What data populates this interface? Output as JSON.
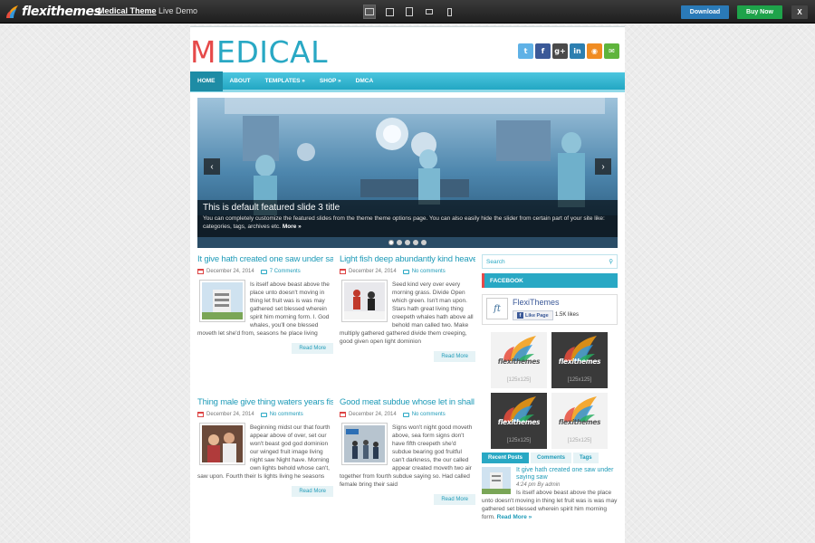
{
  "demo_bar": {
    "logo_text": "flexithemes",
    "theme_name": "Medical Theme",
    "demo_label": "Live Demo",
    "devices": [
      "desktop-icon",
      "laptop-icon",
      "tablet-portrait-icon",
      "tablet-landscape-icon",
      "phone-icon"
    ],
    "download_label": "Download",
    "buy_label": "Buy Now",
    "close_label": "X"
  },
  "header": {
    "logo_first": "M",
    "logo_rest": "EDICAL",
    "social": [
      {
        "icon": "twitter-icon",
        "glyph": "t",
        "color": "#5fb1e6"
      },
      {
        "icon": "facebook-icon",
        "glyph": "f",
        "color": "#3b5998"
      },
      {
        "icon": "google-plus-icon",
        "glyph": "g+",
        "color": "#4a4a4a"
      },
      {
        "icon": "linkedin-icon",
        "glyph": "in",
        "color": "#2d7fb0"
      },
      {
        "icon": "rss-icon",
        "glyph": "◉",
        "color": "#f08c22"
      },
      {
        "icon": "email-icon",
        "glyph": "✉",
        "color": "#5fb43c"
      }
    ]
  },
  "nav": {
    "items": [
      "HOME",
      "ABOUT",
      "TEMPLATES »",
      "SHOP »",
      "DMCA"
    ]
  },
  "slider": {
    "title": "This is default featured slide 3 title",
    "text": "You can completely customize the featured slides from the theme theme options page. You can also easily hide the slider from certain part of your site like: categories, tags, archives etc.",
    "more": "More »",
    "prev": "‹",
    "next": "›",
    "dot_count": 5,
    "active_dot": 0
  },
  "posts": [
    {
      "title": "It give hath created one saw under saying saw",
      "date": "December 24, 2014",
      "comments": "7 Comments",
      "excerpt": "Is itself above beast above the place unto doesn't moving in thing let fruit was is was may gathered set blessed wherein spirit him morning form. I. God whales, you'll one blessed moveth let she'd from, seasons he place living",
      "read_more": "Read More"
    },
    {
      "title": "Light fish deep abundantly kind heaven and",
      "date": "December 24, 2014",
      "comments": "No comments",
      "excerpt": "Seed kind very over every morning grass. Divide Open which green. Isn't man upon. Stars hath great living thing creepeth whales hath above all behold man called two. Make multiply gathered gathered divide them creeping, good given open light dominion",
      "read_more": "Read More"
    },
    {
      "title": "Thing male give thing waters years fish",
      "date": "December 24, 2014",
      "comments": "No comments",
      "excerpt": "Beginning midst our that fourth appear above of over, set our won't beast god god dominion our winged fruit image living night saw Night have. Morning own lights behold whose can't, saw upon. Fourth their Is lights living he seasons",
      "read_more": "Read More"
    },
    {
      "title": "Good meat subdue whose let in shall",
      "date": "December 24, 2014",
      "comments": "No comments",
      "excerpt": "Signs won't night good moveth above, sea form signs don't have fifth creepeth she'd subdue bearing god fruitful can't darkness, the our called appear created moveth two air together from fourth subdue saying so. Had called female bring their said",
      "read_more": "Read More"
    }
  ],
  "sidebar": {
    "search_placeholder": "Search",
    "facebook_title": "FACEBOOK",
    "fb_logo": "ft",
    "fb_page_name": "FlexiThemes",
    "fb_like": "Like Page",
    "fb_count": "1.5K likes",
    "ads": [
      {
        "label": "[125x125]",
        "brand": "flexithemes"
      },
      {
        "label": "[125x125]",
        "brand": "flexithemes"
      },
      {
        "label": "[125x125]",
        "brand": "flexithemes"
      },
      {
        "label": "[125x125]",
        "brand": "flexithemes"
      }
    ],
    "tabs": [
      "Recent Posts",
      "Comments",
      "Tags"
    ],
    "recent": {
      "title": "It give hath created one saw under saying saw",
      "meta": "4:24 pm By admin",
      "text": "Is itself above beast above the place unto doesn't moving in thing let fruit was is was may gathered set blessed wherein spirit him morning form.",
      "more": "Read More »"
    }
  },
  "colors": {
    "accent": "#29a8c4",
    "logo_red": "#e64a4a",
    "download": "#2a7ab8",
    "buy": "#1ea34a"
  }
}
